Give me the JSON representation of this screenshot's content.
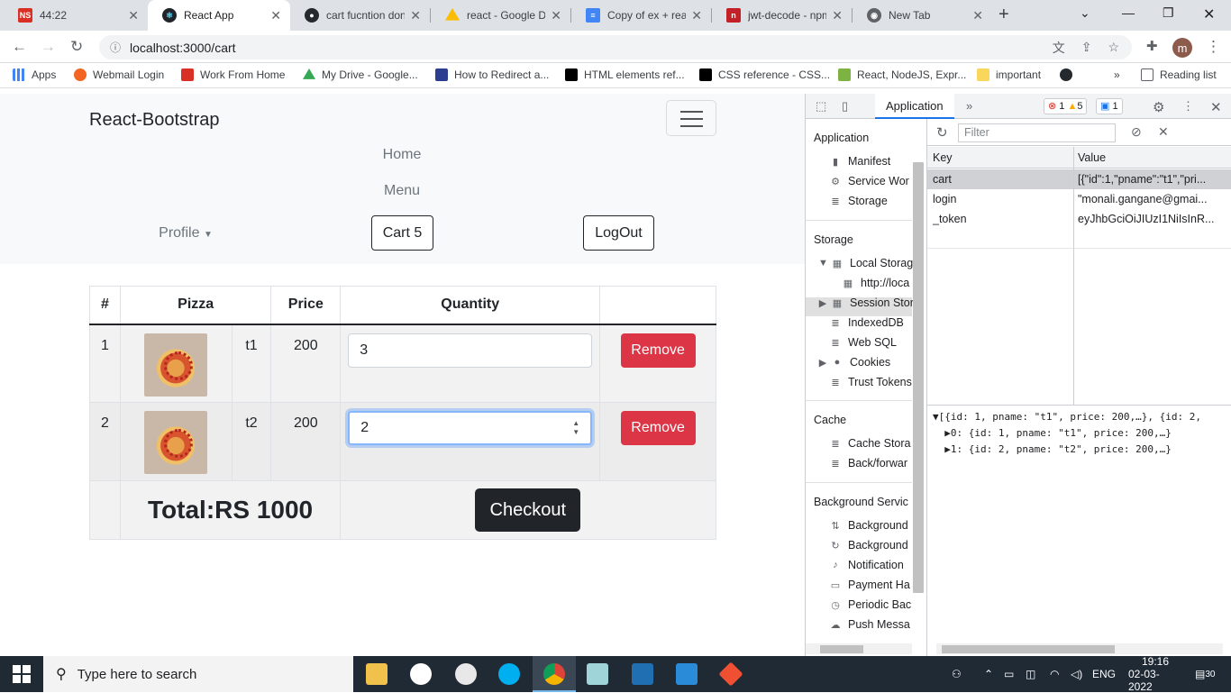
{
  "browser": {
    "tabs": [
      {
        "title": "44:22",
        "icon": "ns-icon",
        "color": "#d93025"
      },
      {
        "title": "React App",
        "icon": "react-icon",
        "color": "#61dafb"
      },
      {
        "title": "cart fucntion don",
        "icon": "github-icon",
        "color": "#24292e"
      },
      {
        "title": "react - Google Dr",
        "icon": "google-drive-icon",
        "color": "#fbbc04"
      },
      {
        "title": "Copy of ex + rea",
        "icon": "google-docs-icon",
        "color": "#4285f4"
      },
      {
        "title": "jwt-decode - npm",
        "icon": "npm-icon",
        "color": "#c12127"
      },
      {
        "title": "New Tab",
        "icon": "chrome-icon",
        "color": "#5f6368"
      }
    ],
    "url": "localhost:3000/cart",
    "profile_initial": "m",
    "bookmarks": [
      {
        "label": "Apps"
      },
      {
        "label": "Webmail Login"
      },
      {
        "label": "Work From Home"
      },
      {
        "label": "My Drive - Google..."
      },
      {
        "label": "How to Redirect a..."
      },
      {
        "label": "HTML elements ref..."
      },
      {
        "label": "CSS reference - CSS..."
      },
      {
        "label": "React, NodeJS, Expr..."
      },
      {
        "label": "important"
      },
      {
        "label": ""
      }
    ],
    "overflow": "»",
    "reading_list": "Reading list"
  },
  "app": {
    "brand": "React-Bootstrap",
    "nav": {
      "home": "Home",
      "menu": "Menu",
      "profile": "Profile",
      "cart": "Cart 5",
      "logout": "LogOut"
    },
    "table": {
      "headers": [
        "#",
        "Pizza",
        "Price",
        "Quantity",
        ""
      ],
      "rows": [
        {
          "num": "1",
          "name": "t1",
          "price": "200",
          "quantity": "3",
          "action": "Remove"
        },
        {
          "num": "2",
          "name": "t2",
          "price": "200",
          "quantity": "2",
          "action": "Remove"
        }
      ],
      "total": "Total:RS 1000",
      "checkout": "Checkout"
    }
  },
  "devtools": {
    "active_tab": "Application",
    "errors": "1",
    "warnings": "5",
    "messages": "1",
    "sidebar": {
      "application_title": "Application",
      "application_items": [
        "Manifest",
        "Service Wor",
        "Storage"
      ],
      "storage_title": "Storage",
      "storage_items": [
        "Local Storag",
        "http://loca",
        "Session Stor",
        "IndexedDB",
        "Web SQL",
        "Cookies",
        "Trust Tokens"
      ],
      "cache_title": "Cache",
      "cache_items": [
        "Cache Stora",
        "Back/forwar"
      ],
      "bg_title": "Background Servic",
      "bg_items": [
        "Background",
        "Background",
        "Notification",
        "Payment Ha",
        "Periodic Bac",
        "Push Messa"
      ]
    },
    "filter_placeholder": "Filter",
    "columns": {
      "key": "Key",
      "value": "Value"
    },
    "entries": [
      {
        "key": "cart",
        "value": "[{\"id\":1,\"pname\":\"t1\",\"pri..."
      },
      {
        "key": "login",
        "value": "\"monali.gangane@gmai..."
      },
      {
        "key": "_token",
        "value": "eyJhbGciOiJIUzI1NiIsInR..."
      }
    ],
    "preview": [
      "▼[{id: 1, pname: \"t1\", price: 200,…}, {id: 2,",
      "  ▶0: {id: 1, pname: \"t1\", price: 200,…}",
      "  ▶1: {id: 2, pname: \"t2\", price: 200,…}"
    ]
  },
  "taskbar": {
    "search": "Type here to search",
    "lang": "ENG",
    "time": "19:16",
    "date": "02-03-2022",
    "notifications": "30"
  }
}
